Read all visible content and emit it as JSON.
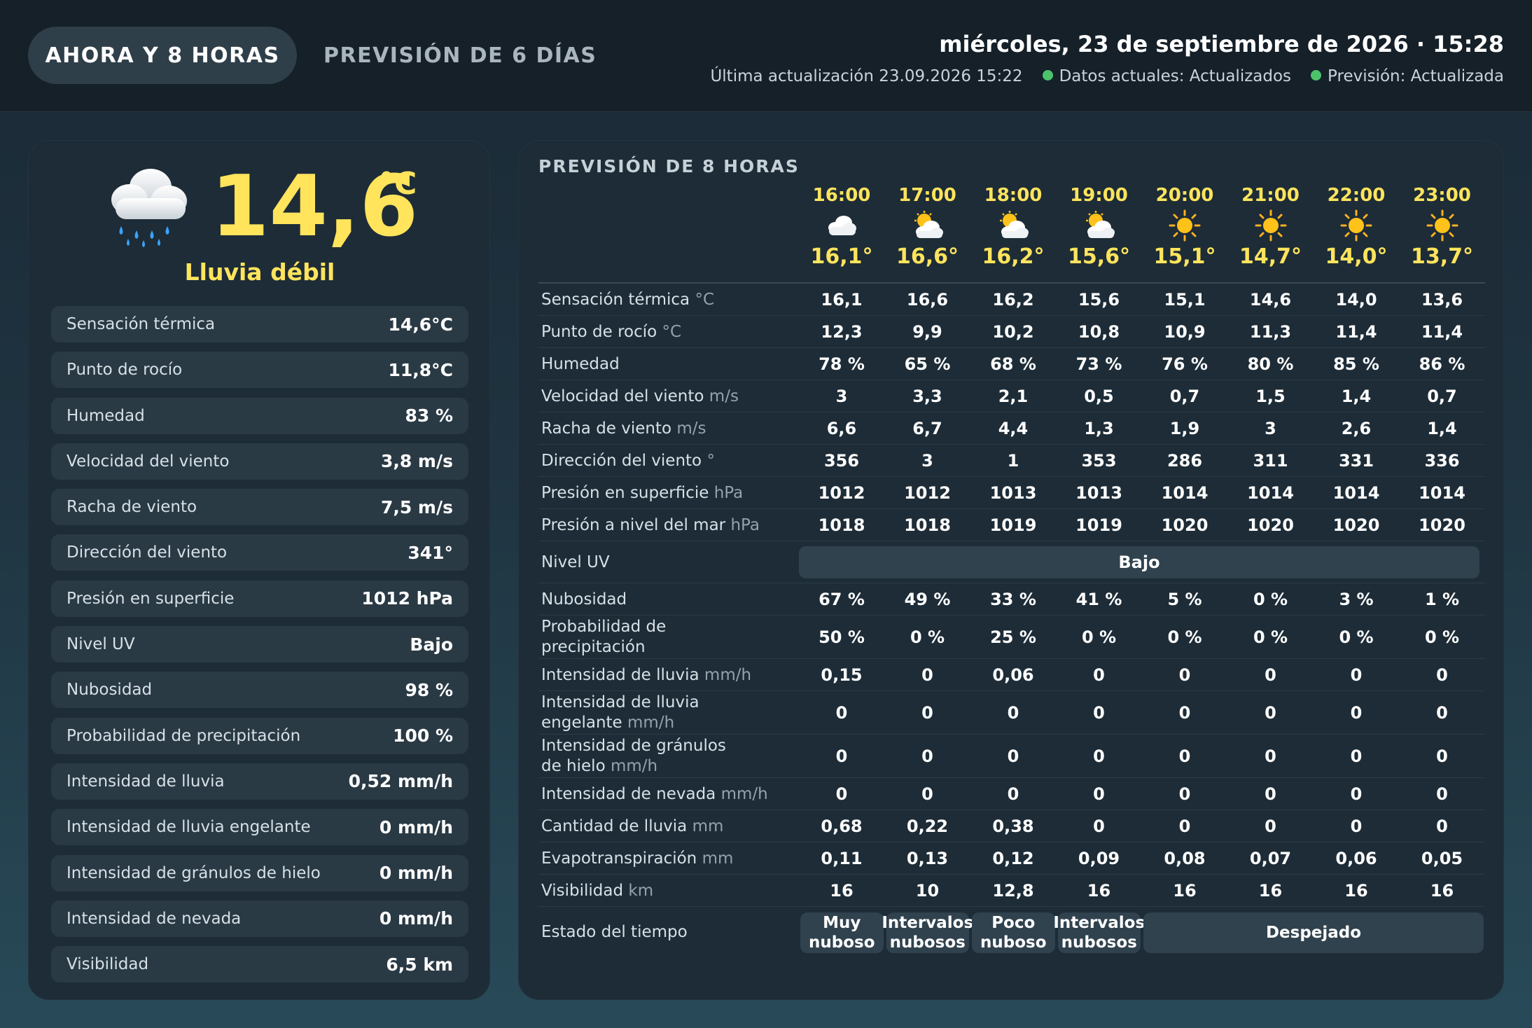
{
  "tabs": {
    "now": "AHORA Y 8 HORAS",
    "forecast": "PREVISIÓN DE 6 DÍAS"
  },
  "header": {
    "datetime": "miércoles, 23 de septiembre de 2026 · 15:28",
    "last_update": "Última actualización 23.09.2026 15:22",
    "current_status": "Datos actuales: Actualizados",
    "forecast_status": "Previsión: Actualizada"
  },
  "current": {
    "icon": "rain-cloud-icon",
    "temp": "14,6",
    "unit": "°C",
    "desc": "Lluvia débil",
    "rows": [
      {
        "label": "Sensación térmica",
        "value": "14,6°C"
      },
      {
        "label": "Punto de rocío",
        "value": "11,8°C"
      },
      {
        "label": "Humedad",
        "value": "83 %"
      },
      {
        "label": "Velocidad del viento",
        "value": "3,8 m/s"
      },
      {
        "label": "Racha de viento",
        "value": "7,5 m/s"
      },
      {
        "label": "Dirección del viento",
        "value": "341°"
      },
      {
        "label": "Presión en superficie",
        "value": "1012 hPa"
      },
      {
        "label": "Nivel UV",
        "value": "Bajo"
      },
      {
        "label": "Nubosidad",
        "value": "98 %"
      },
      {
        "label": "Probabilidad de precipitación",
        "value": "100 %"
      },
      {
        "label": "Intensidad de lluvia",
        "value": "0,52 mm/h"
      },
      {
        "label": "Intensidad de lluvia engelante",
        "value": "0 mm/h"
      },
      {
        "label": "Intensidad de gránulos de hielo",
        "value": "0 mm/h"
      },
      {
        "label": "Intensidad de nevada",
        "value": "0 mm/h"
      },
      {
        "label": "Visibilidad",
        "value": "6,5 km"
      }
    ]
  },
  "forecast": {
    "title": "PREVISIÓN DE 8 HORAS",
    "hours": [
      {
        "time": "16:00",
        "icon": "cloud-icon",
        "temp": "16,1°"
      },
      {
        "time": "17:00",
        "icon": "sun-behind-cloud-icon",
        "temp": "16,6°"
      },
      {
        "time": "18:00",
        "icon": "sun-behind-cloud-icon",
        "temp": "16,2°"
      },
      {
        "time": "19:00",
        "icon": "sun-behind-cloud-icon",
        "temp": "15,6°"
      },
      {
        "time": "20:00",
        "icon": "sun-icon",
        "temp": "15,1°"
      },
      {
        "time": "21:00",
        "icon": "sun-icon",
        "temp": "14,7°"
      },
      {
        "time": "22:00",
        "icon": "sun-icon",
        "temp": "14,0°"
      },
      {
        "time": "23:00",
        "icon": "sun-icon",
        "temp": "13,7°"
      }
    ],
    "rows": [
      {
        "label": "Sensación térmica",
        "unit": "°C",
        "values": [
          "16,1",
          "16,6",
          "16,2",
          "15,6",
          "15,1",
          "14,6",
          "14,0",
          "13,6"
        ]
      },
      {
        "label": "Punto de rocío",
        "unit": "°C",
        "values": [
          "12,3",
          "9,9",
          "10,2",
          "10,8",
          "10,9",
          "11,3",
          "11,4",
          "11,4"
        ]
      },
      {
        "label": "Humedad",
        "unit": "",
        "values": [
          "78 %",
          "65 %",
          "68 %",
          "73 %",
          "76 %",
          "80 %",
          "85 %",
          "86 %"
        ]
      },
      {
        "label": "Velocidad del viento",
        "unit": "m/s",
        "values": [
          "3",
          "3,3",
          "2,1",
          "0,5",
          "0,7",
          "1,5",
          "1,4",
          "0,7"
        ]
      },
      {
        "label": "Racha de viento",
        "unit": "m/s",
        "values": [
          "6,6",
          "6,7",
          "4,4",
          "1,3",
          "1,9",
          "3",
          "2,6",
          "1,4"
        ]
      },
      {
        "label": "Dirección del viento",
        "unit": "°",
        "values": [
          "356",
          "3",
          "1",
          "353",
          "286",
          "311",
          "331",
          "336"
        ]
      },
      {
        "label": "Presión en superficie",
        "unit": "hPa",
        "values": [
          "1012",
          "1012",
          "1013",
          "1013",
          "1014",
          "1014",
          "1014",
          "1014"
        ]
      },
      {
        "label": "Presión a nivel del mar",
        "unit": "hPa",
        "values": [
          "1018",
          "1018",
          "1019",
          "1019",
          "1020",
          "1020",
          "1020",
          "1020"
        ]
      }
    ],
    "uv": {
      "label": "Nivel UV",
      "value": "Bajo"
    },
    "rows2": [
      {
        "label": "Nubosidad",
        "unit": "",
        "values": [
          "67 %",
          "49 %",
          "33 %",
          "41 %",
          "5 %",
          "0 %",
          "3 %",
          "1 %"
        ]
      },
      {
        "label": "Probabilidad de precipitación",
        "unit": "",
        "values": [
          "50 %",
          "0 %",
          "25 %",
          "0 %",
          "0 %",
          "0 %",
          "0 %",
          "0 %"
        ]
      },
      {
        "label": "Intensidad de lluvia",
        "unit": "mm/h",
        "values": [
          "0,15",
          "0",
          "0,06",
          "0",
          "0",
          "0",
          "0",
          "0"
        ]
      },
      {
        "label": "Intensidad de lluvia engelante",
        "unit": "mm/h",
        "values": [
          "0",
          "0",
          "0",
          "0",
          "0",
          "0",
          "0",
          "0"
        ]
      },
      {
        "label": "Intensidad de gránulos de hielo",
        "unit": "mm/h",
        "values": [
          "0",
          "0",
          "0",
          "0",
          "0",
          "0",
          "0",
          "0"
        ]
      },
      {
        "label": "Intensidad de nevada",
        "unit": "mm/h",
        "values": [
          "0",
          "0",
          "0",
          "0",
          "0",
          "0",
          "0",
          "0"
        ]
      },
      {
        "label": "Cantidad de lluvia",
        "unit": "mm",
        "values": [
          "0,68",
          "0,22",
          "0,38",
          "0",
          "0",
          "0",
          "0",
          "0"
        ]
      },
      {
        "label": "Evapotranspiración",
        "unit": "mm",
        "values": [
          "0,11",
          "0,13",
          "0,12",
          "0,09",
          "0,08",
          "0,07",
          "0,06",
          "0,05"
        ]
      },
      {
        "label": "Visibilidad",
        "unit": "km",
        "values": [
          "16",
          "10",
          "12,8",
          "16",
          "16",
          "16",
          "16",
          "16"
        ]
      }
    ],
    "weather": {
      "label": "Estado del tiempo",
      "states": [
        {
          "text": "Muy nuboso",
          "span": 1
        },
        {
          "text": "Intervalos nubosos",
          "span": 1
        },
        {
          "text": "Poco nuboso",
          "span": 1
        },
        {
          "text": "Intervalos nubosos",
          "span": 1
        },
        {
          "text": "Despejado",
          "span": 4
        }
      ]
    }
  },
  "colors": {
    "accent": "#ffe45c",
    "status_ok": "#4cc36a",
    "panel": "#1d2c37",
    "row": "#2a3a45"
  }
}
